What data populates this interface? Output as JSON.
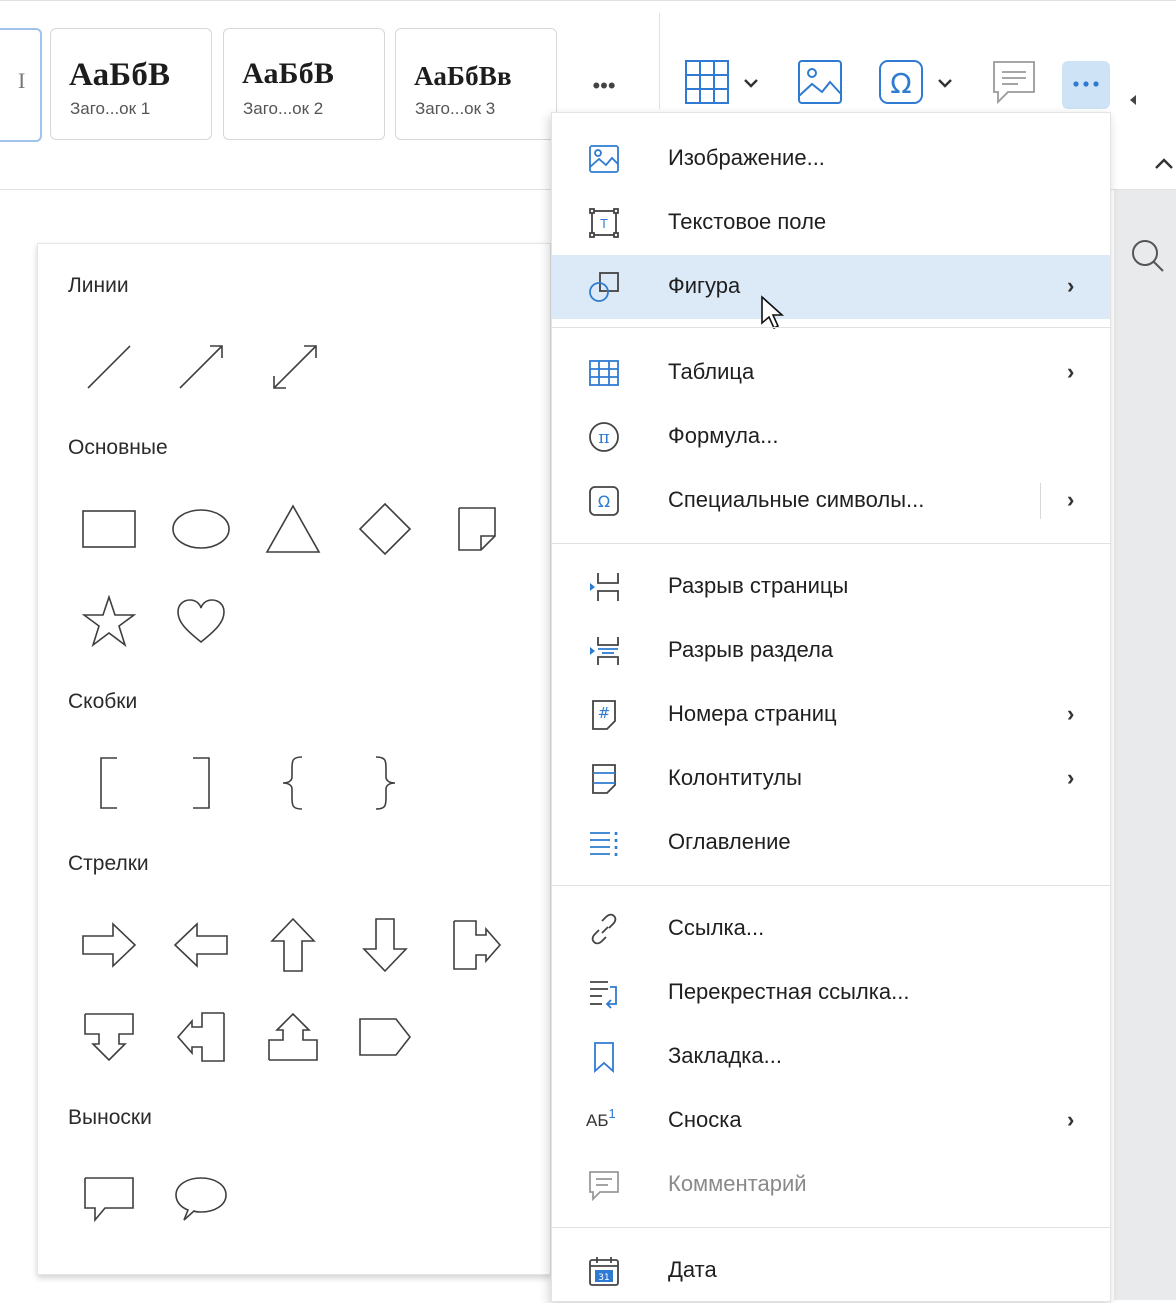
{
  "ribbon": {
    "styles": [
      {
        "sample": "АаБбВ",
        "caption": "Заго...ок 1"
      },
      {
        "sample": "АаБбВ",
        "caption": "Заго...ок 2"
      },
      {
        "sample": "АаБбВв",
        "caption": "Заго...ок 3"
      }
    ],
    "more_styles_label": "•••",
    "partial_first_style_glyph": "I"
  },
  "shapes_panel": {
    "sections": {
      "lines": "Линии",
      "basic": "Основные",
      "brackets": "Скобки",
      "arrows": "Стрелки",
      "callouts": "Выноски"
    }
  },
  "menu": {
    "items": [
      {
        "label": "Изображение...",
        "icon": "image-icon"
      },
      {
        "label": "Текстовое поле",
        "icon": "text-box-icon"
      },
      {
        "label": "Фигура",
        "icon": "shape-icon",
        "submenu": true,
        "highlighted": true
      },
      {
        "label": "Таблица",
        "icon": "table-icon",
        "submenu": true
      },
      {
        "label": "Формула...",
        "icon": "pi-icon"
      },
      {
        "label": "Специальные символы...",
        "icon": "omega-icon",
        "submenu": true
      },
      {
        "label": "Разрыв страницы",
        "icon": "page-break-icon"
      },
      {
        "label": "Разрыв раздела",
        "icon": "section-break-icon"
      },
      {
        "label": "Номера страниц",
        "icon": "page-numbers-icon",
        "submenu": true
      },
      {
        "label": "Колонтитулы",
        "icon": "header-footer-icon",
        "submenu": true
      },
      {
        "label": "Оглавление",
        "icon": "toc-icon"
      },
      {
        "label": "Ссылка...",
        "icon": "link-icon"
      },
      {
        "label": "Перекрестная ссылка...",
        "icon": "cross-reference-icon"
      },
      {
        "label": "Закладка...",
        "icon": "bookmark-icon"
      },
      {
        "label": "Сноска",
        "icon": "footnote-icon",
        "submenu": true,
        "icon_text": "АБ",
        "icon_sup": "1"
      },
      {
        "label": "Комментарий",
        "icon": "comment-icon",
        "disabled": true
      },
      {
        "label": "Дата",
        "icon": "calendar-icon",
        "icon_text": "31"
      }
    ],
    "submenu_arrow": "›"
  },
  "colors": {
    "accent": "#2f7bd1",
    "hover": "#dceaf8",
    "dots_button_bg": "#cfe3f7",
    "side_area": "#e9eaec"
  }
}
